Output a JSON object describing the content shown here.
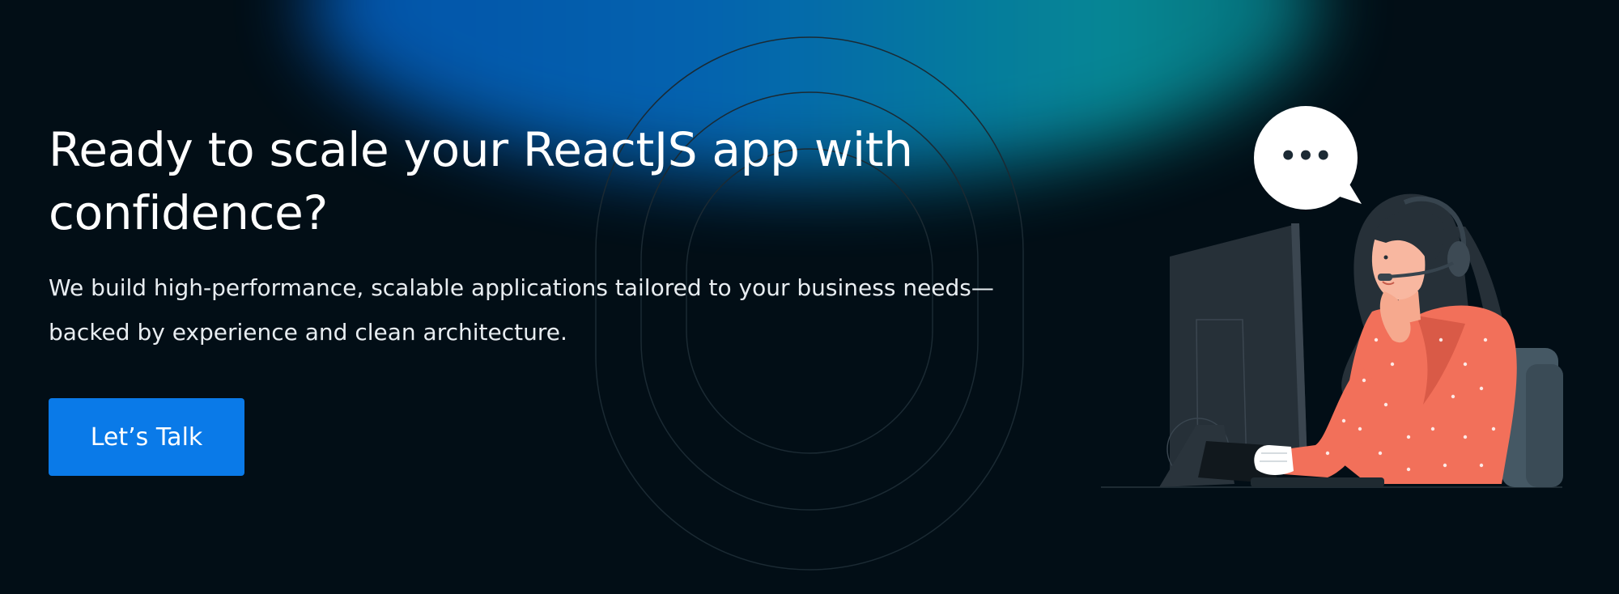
{
  "hero": {
    "title_line1": "Ready to scale your ReactJS app with",
    "title_line2": "confidence?",
    "description_line1": "We build high-performance, scalable applications tailored to your business needs—",
    "description_line2": "backed by experience and clean architecture.",
    "cta_label": "Let’s Talk"
  },
  "illustration": {
    "bubble_text": "•••",
    "icon": "customer-support-agent-illustration"
  },
  "colors": {
    "background": "#020e16",
    "cta": "#0a7ae8",
    "glow_blue": "#0568b8",
    "glow_teal": "#078f9b",
    "shirt": "#f2705a"
  }
}
